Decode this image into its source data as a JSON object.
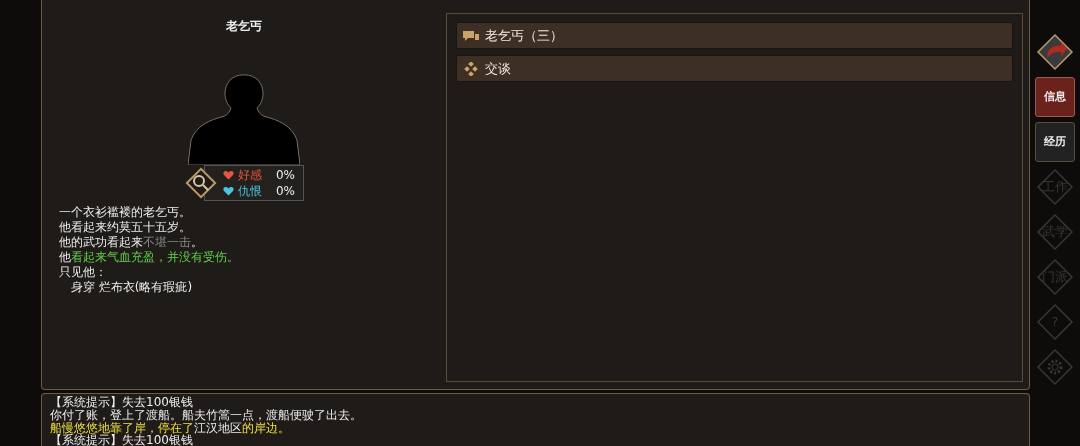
{
  "npc": {
    "name": "老乞丐",
    "favor": {
      "label": "好感",
      "value": "0%"
    },
    "hatred": {
      "label": "仇恨",
      "value": "0%"
    },
    "description": [
      [
        {
          "text": "一个衣衫褴褛的老乞丐。"
        }
      ],
      [
        {
          "text": "他看起来约莫五十五岁。"
        }
      ],
      [
        {
          "text": "他的武功看起来"
        },
        {
          "text": "不堪一击",
          "kind": "dim"
        },
        {
          "text": "。"
        }
      ],
      [
        {
          "text": "他"
        },
        {
          "text": "看起来气血充盈，并没有受伤。",
          "kind": "good"
        }
      ],
      [
        {
          "text": "只见他："
        }
      ],
      [
        {
          "text": "　身穿 烂布衣(略有瑕疵)"
        }
      ]
    ]
  },
  "options": [
    {
      "kind": "chat",
      "label": "老乞丐（三）"
    },
    {
      "kind": "talk",
      "label": "交谈"
    }
  ],
  "sidebar": [
    {
      "kind": "back",
      "disabled": false,
      "selected": false
    },
    {
      "kind": "text",
      "label": "信息",
      "disabled": false,
      "selected": true
    },
    {
      "kind": "text",
      "label": "经历",
      "disabled": false,
      "selected": false
    },
    {
      "kind": "diamond",
      "label": "工作",
      "disabled": true,
      "selected": false
    },
    {
      "kind": "diamond",
      "label": "武学",
      "disabled": true,
      "selected": false
    },
    {
      "kind": "diamond",
      "label": "门派",
      "disabled": true,
      "selected": false
    },
    {
      "kind": "diamond",
      "label": "?",
      "disabled": true,
      "selected": false
    },
    {
      "kind": "gear",
      "disabled": true,
      "selected": false
    }
  ],
  "log": [
    [
      {
        "text": "【系统提示】失去100银钱"
      }
    ],
    [
      {
        "text": "你付了账，登上了渡船。船夫竹篙一点，渡船便驶了出去。"
      }
    ],
    [
      {
        "text": "船慢悠悠地靠了岸，停在了",
        "kind": "notice"
      },
      {
        "text": "江汉地区"
      },
      {
        "text": "的岸边。",
        "kind": "notice"
      }
    ],
    [
      {
        "text": "【系统提示】失去100银钱"
      }
    ]
  ]
}
